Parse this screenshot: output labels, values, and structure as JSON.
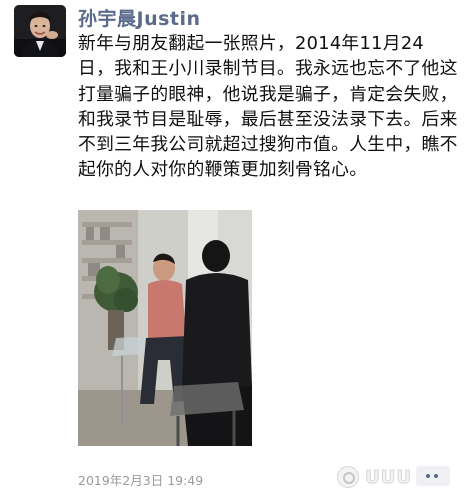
{
  "post": {
    "author": "孙宇晨Justin",
    "text": "新年与朋友翻起一张照片，2014年11月24日，我和王小川录制节目。我永远也忘不了他这打量骗子的眼神，他说我是骗子，肯定会失败，和我录节目是耻辱，最后甚至没法录下去。后来不到三年我公司就超过搜狗市值。人生中，瞧不起你的人对你的鞭策更加刻骨铭心。",
    "timestamp": "2019年2月3日 19:49"
  },
  "icons": {
    "avatar": "profile-photo",
    "comment": "more-dots-icon",
    "watermark": "watermark-logo"
  },
  "watermark": {
    "text": "UUU"
  },
  "colors": {
    "author_name": "#5b6b8c",
    "body_text": "#111111",
    "timestamp": "#9a9a9a",
    "background": "#ffffff"
  }
}
